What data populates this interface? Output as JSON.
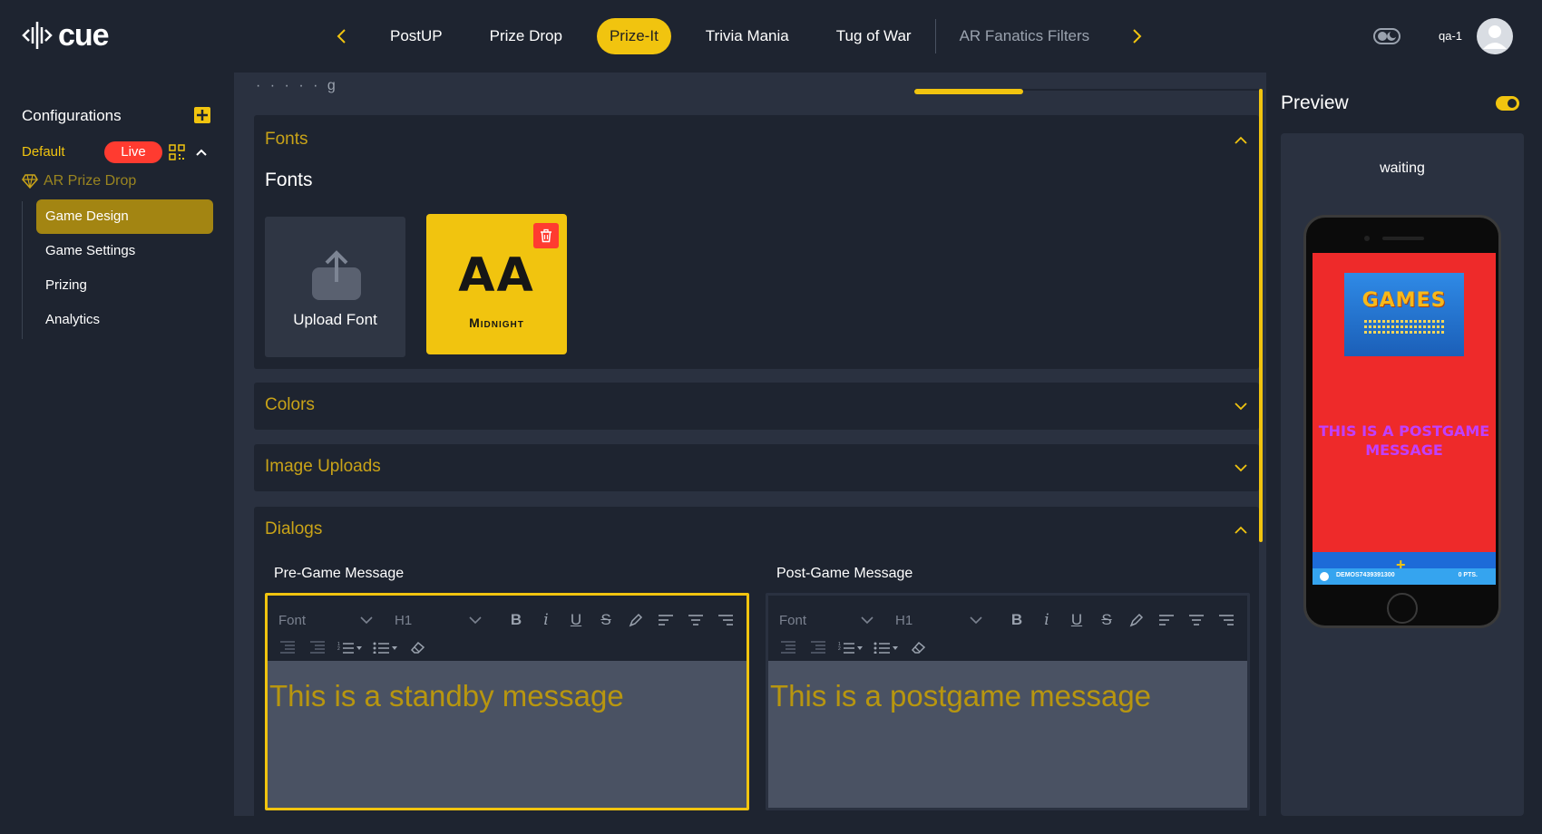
{
  "app": {
    "logo_text": "cue"
  },
  "topnav": {
    "tabs": [
      {
        "label": "PostUP",
        "state": "normal"
      },
      {
        "label": "Prize Drop",
        "state": "normal"
      },
      {
        "label": "Prize-It",
        "state": "active"
      },
      {
        "label": "Trivia Mania",
        "state": "normal"
      },
      {
        "label": "Tug of War",
        "state": "normal"
      },
      {
        "label": "AR Fanatics Filters",
        "state": "dim"
      }
    ],
    "user": "qa-1"
  },
  "sidebar": {
    "title": "Configurations",
    "default_label": "Default",
    "live_label": "Live",
    "game_name": "AR Prize Drop",
    "items": [
      {
        "label": "Game Design",
        "active": true
      },
      {
        "label": "Game Settings",
        "active": false
      },
      {
        "label": "Prizing",
        "active": false
      },
      {
        "label": "Analytics",
        "active": false
      }
    ]
  },
  "main": {
    "partial_heading": "· · · · · g",
    "fonts": {
      "section_title": "Fonts",
      "subtitle": "Fonts",
      "upload_label": "Upload Font",
      "font_preview": "AA",
      "font_name": "Midnight"
    },
    "colors": {
      "section_title": "Colors"
    },
    "image_uploads": {
      "section_title": "Image Uploads"
    },
    "dialogs": {
      "section_title": "Dialogs",
      "pre_game": {
        "label": "Pre-Game Message",
        "font_placeholder": "Font",
        "heading_value": "H1",
        "text": "This is a standby message"
      },
      "post_game": {
        "label": "Post-Game Message",
        "font_placeholder": "Font",
        "heading_value": "H1",
        "text": "This is a postgame message"
      }
    }
  },
  "preview": {
    "title": "Preview",
    "status": "waiting",
    "games_word": "GAMES",
    "message": "THIS IS A POSTGAME MESSAGE",
    "player_id": "DEMOS7439391300",
    "points": "0 PTS."
  },
  "colors": {
    "accent": "#f1c40f",
    "background": "#1e2430",
    "panel": "#2a3140",
    "live": "#ff3b30",
    "section_heading": "#c9a318"
  }
}
